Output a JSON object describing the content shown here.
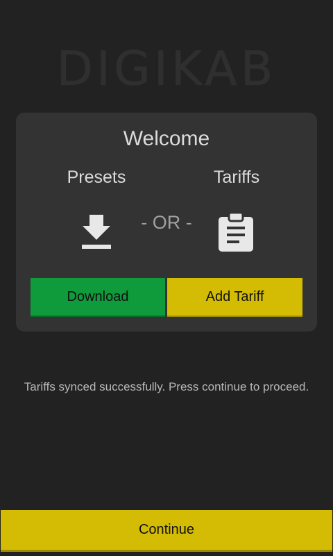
{
  "app": {
    "logo_text": "DIGIKAB"
  },
  "card": {
    "title": "Welcome",
    "left_label": "Presets",
    "right_label": "Tariffs",
    "separator": "- OR -",
    "left_icon": "download-icon",
    "right_icon": "clipboard-icon",
    "download_button": "Download",
    "add_tariff_button": "Add Tariff"
  },
  "status_message": "Tariffs synced successfully. Press continue to proceed.",
  "footer": {
    "continue_button": "Continue"
  },
  "colors": {
    "background": "#222222",
    "card": "#333333",
    "download_green": "#0f9a3c",
    "accent_yellow": "#d4bc05"
  }
}
